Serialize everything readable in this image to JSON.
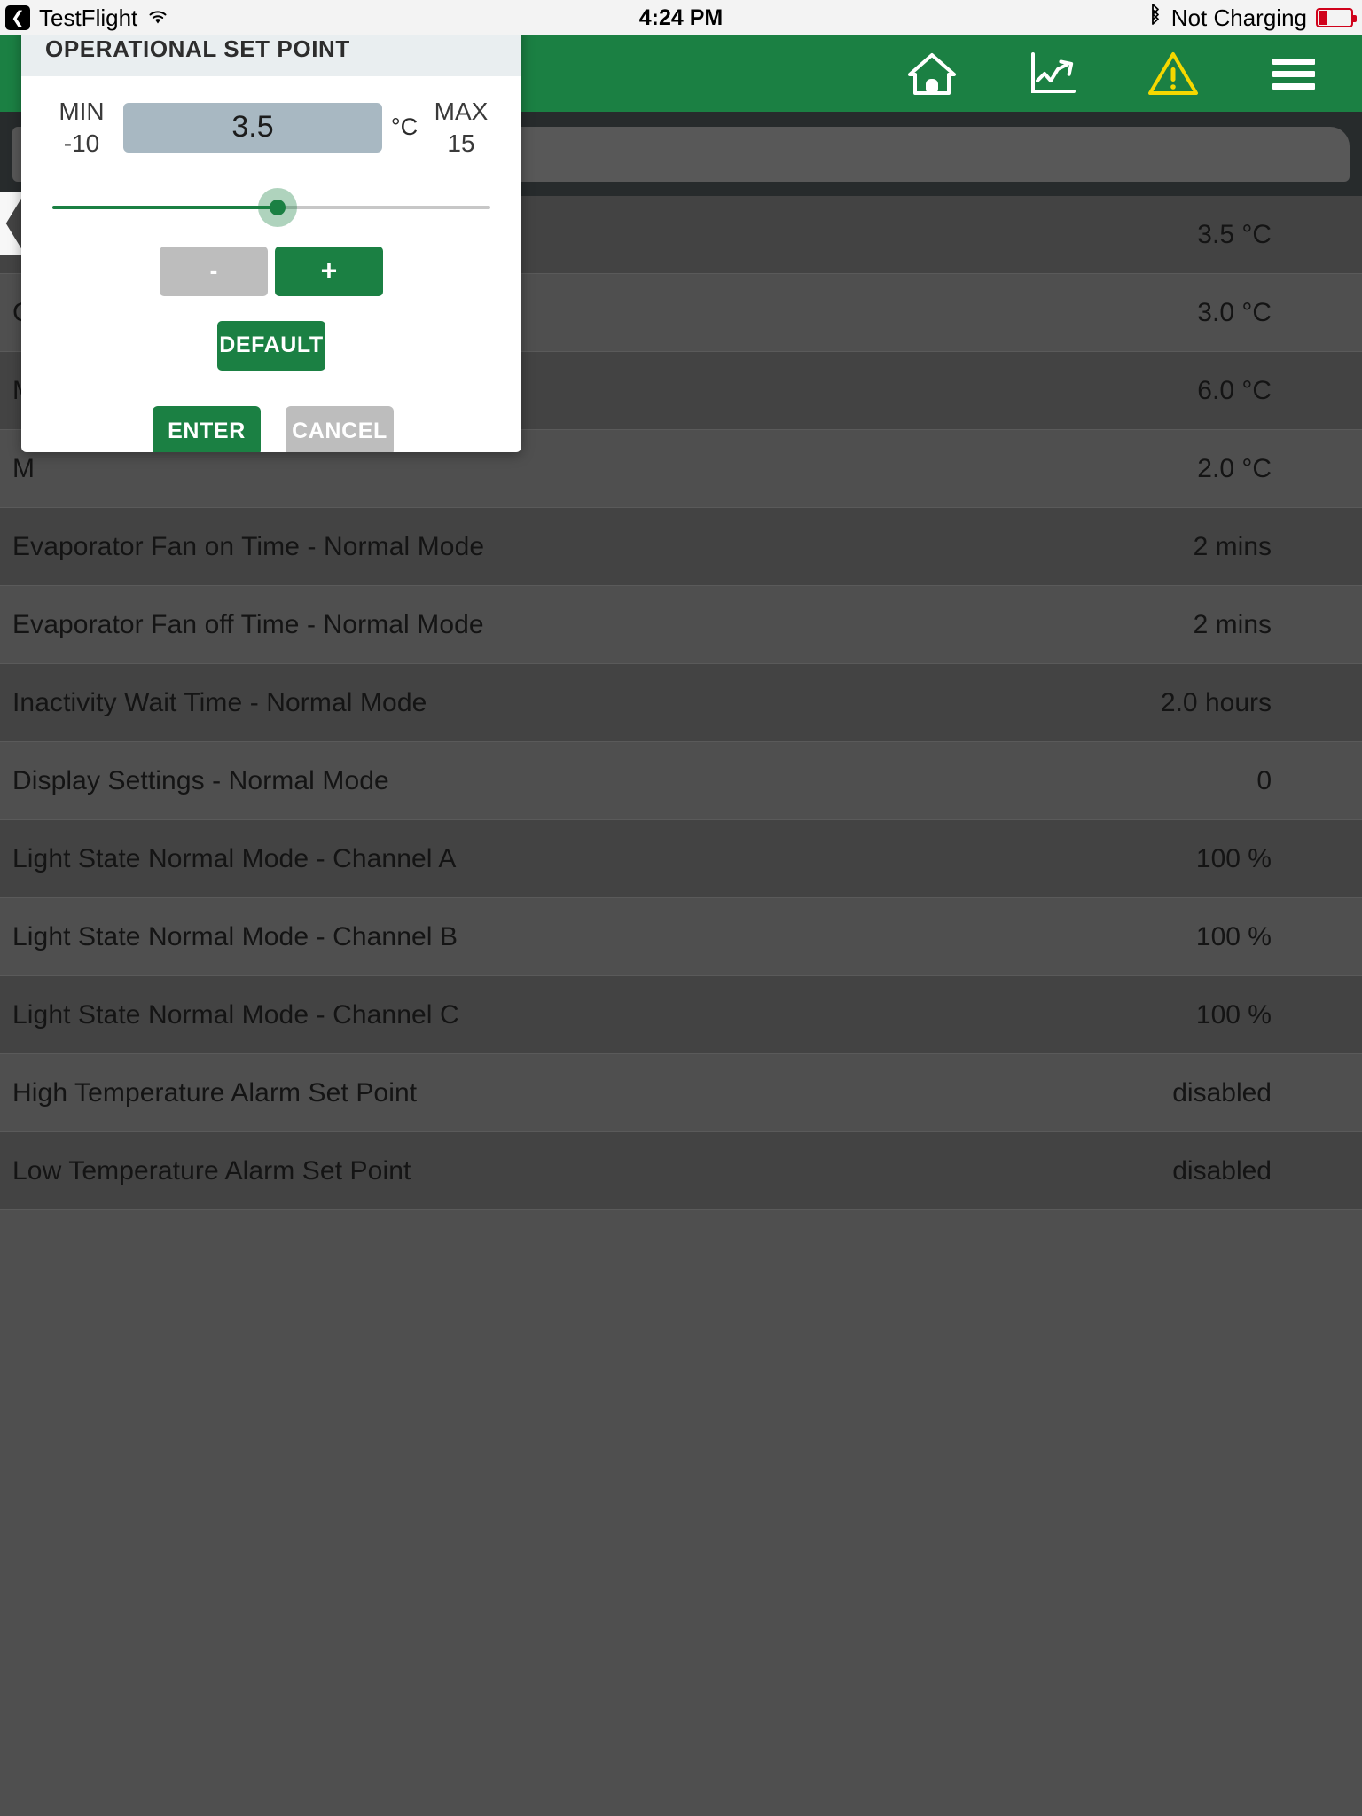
{
  "status_bar": {
    "back_label": "TestFlight",
    "back_icon": "chevron-left-icon",
    "wifi_icon": "wifi-icon",
    "time": "4:24 PM",
    "bluetooth_icon": "bluetooth-icon",
    "power_status": "Not Charging",
    "battery_icon": "battery-low-icon"
  },
  "app_header": {
    "background_color": "#1b8043",
    "icons": [
      {
        "name": "home-icon",
        "label": "Home"
      },
      {
        "name": "chart-trend-icon",
        "label": "Trends"
      },
      {
        "name": "alarm-warning-icon",
        "label": "Alarms",
        "color": "#f5d800"
      },
      {
        "name": "hamburger-menu-icon",
        "label": "Menu"
      }
    ]
  },
  "toolbar": {
    "search_value": "",
    "search_placeholder": ""
  },
  "back_arrow": {
    "name": "page-back-chevron"
  },
  "settings_list": {
    "rows": [
      {
        "label": "",
        "value": "3.5 °C"
      },
      {
        "label": "C",
        "value": "3.0 °C"
      },
      {
        "label": "M",
        "value": "6.0 °C"
      },
      {
        "label": "M",
        "value": "2.0 °C"
      },
      {
        "label": "Evaporator Fan on Time - Normal Mode",
        "value": "2 mins"
      },
      {
        "label": "Evaporator Fan off Time - Normal Mode",
        "value": "2 mins"
      },
      {
        "label": "Inactivity Wait Time - Normal Mode",
        "value": "2.0 hours"
      },
      {
        "label": "Display Settings - Normal Mode",
        "value": "0"
      },
      {
        "label": "Light State Normal Mode - Channel A",
        "value": "100 %"
      },
      {
        "label": "Light State Normal Mode - Channel B",
        "value": "100 %"
      },
      {
        "label": "Light State Normal Mode - Channel C",
        "value": "100 %"
      },
      {
        "label": "High Temperature Alarm Set Point",
        "value": "disabled"
      },
      {
        "label": "Low Temperature Alarm Set Point",
        "value": "disabled"
      }
    ]
  },
  "dialog": {
    "title": "OPERATIONAL SET POINT",
    "min_caption": "MIN",
    "min_value": "-10",
    "max_caption": "MAX",
    "max_value": "15",
    "current_value": "3.5",
    "unit": "°C",
    "slider_percent": 51.5,
    "minus_label": "-",
    "plus_label": "+",
    "default_label": "DEFAULT",
    "enter_label": "ENTER",
    "cancel_label": "CANCEL"
  },
  "colors": {
    "brand_green": "#1b8043",
    "warn_yellow": "#f5d800",
    "input_blue_grey": "#a8b8c2",
    "disabled_grey": "#bdbdbd",
    "list_row_dark": "#434343",
    "list_row_light": "#4f4f4f"
  }
}
